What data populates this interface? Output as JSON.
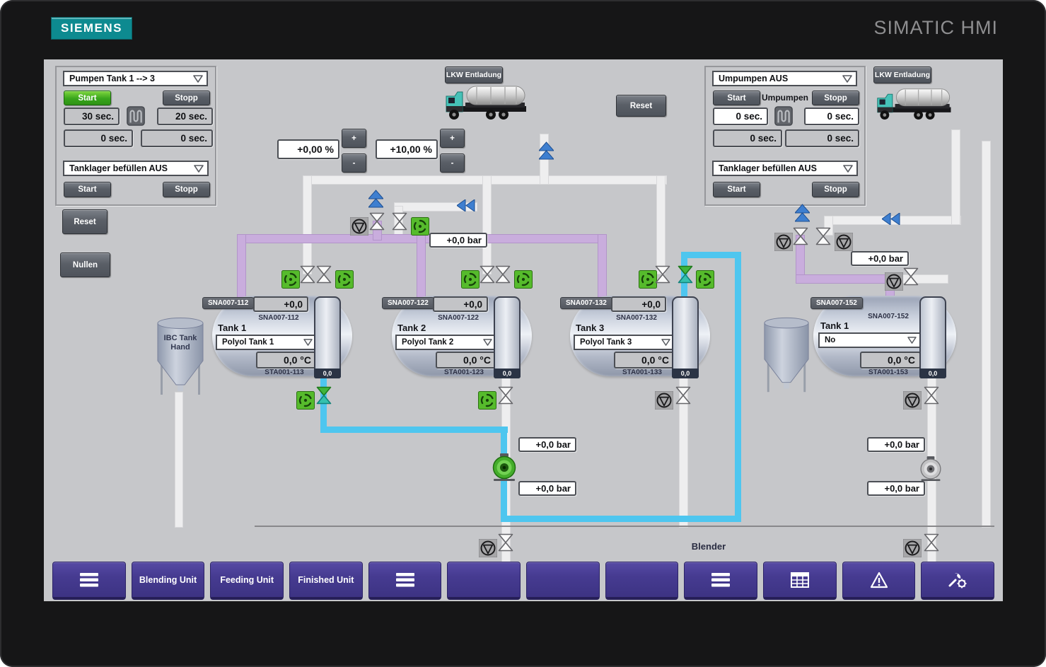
{
  "brand": {
    "logo": "SIEMENS",
    "product": "SIMATIC HMI"
  },
  "panels": {
    "left": {
      "mode": "Pumpen Tank 1 --> 3",
      "start": "Start",
      "stopp": "Stopp",
      "t1": "30 sec.",
      "t2": "20 sec.",
      "t3": "0 sec.",
      "t4": "0 sec.",
      "tanklager": "Tanklager befüllen AUS",
      "start2": "Start",
      "stopp2": "Stopp"
    },
    "right": {
      "mode": "Umpumpen AUS",
      "start": "Start",
      "label": "Umpumpen",
      "stopp": "Stopp",
      "t1": "0 sec.",
      "t2": "0 sec.",
      "t3": "0 sec.",
      "t4": "0 sec.",
      "tanklager": "Tanklager befüllen AUS",
      "start2": "Start",
      "stopp2": "Stopp"
    }
  },
  "buttons": {
    "reset": "Reset",
    "nullen": "Nullen",
    "reset_mid": "Reset",
    "lkw_left": "LKW Entladung",
    "lkw_right": "LKW Entladung"
  },
  "dosing": {
    "v1": "+0,00 %",
    "v2": "+10,00 %",
    "plus": "+",
    "minus": "-"
  },
  "pressures": [
    "+0,0 bar",
    "+0,0 bar",
    "+0,0 bar",
    "+0,0 bar",
    "+0,0 bar",
    "+0,0 bar"
  ],
  "tanks": [
    {
      "badge": "SNA007-112",
      "flow": "+0,0",
      "flow_label": "SNA007-112",
      "title": "Tank 1",
      "select": "Polyol Tank 1",
      "temp": "0,0 °C",
      "temp_label": "STA001-113",
      "level": "0,0"
    },
    {
      "badge": "SNA007-122",
      "flow": "+0,0",
      "flow_label": "SNA007-122",
      "title": "Tank 2",
      "select": "Polyol Tank 2",
      "temp": "0,0 °C",
      "temp_label": "STA001-123",
      "level": "0,0"
    },
    {
      "badge": "SNA007-132",
      "flow": "+0,0",
      "flow_label": "SNA007-132",
      "title": "Tank 3",
      "select": "Polyol Tank 3",
      "temp": "0,0 °C",
      "temp_label": "STA001-133",
      "level": "0,0"
    },
    {
      "badge": "SNA007-152",
      "flow_label": "SNA007-152",
      "title": "Tank 1",
      "select": "No",
      "temp": "0,0 °C",
      "temp_label": "STA001-153",
      "level": "0,0"
    }
  ],
  "labels": {
    "ibc": "IBC Tank Hand",
    "blender": "Blender"
  },
  "nav": {
    "items": [
      {
        "icon": "menu",
        "label": ""
      },
      {
        "icon": "",
        "label": "Blending Unit"
      },
      {
        "icon": "",
        "label": "Feeding Unit"
      },
      {
        "icon": "",
        "label": "Finished Unit"
      },
      {
        "icon": "menu",
        "label": ""
      },
      {
        "icon": "",
        "label": ""
      },
      {
        "icon": "",
        "label": ""
      },
      {
        "icon": "",
        "label": ""
      },
      {
        "icon": "menu",
        "label": ""
      },
      {
        "icon": "grid",
        "label": ""
      },
      {
        "icon": "alarm",
        "label": ""
      },
      {
        "icon": "tools",
        "label": ""
      }
    ]
  },
  "colors": {
    "accent_green": "#3fae27",
    "pipe_purple": "#c9addd",
    "pipe_cyan": "#4ec6ef",
    "nav_purple": "#463b91",
    "siemens_teal": "#0d8a90",
    "start_green": "#38a51c",
    "screen_gray": "#c6c7ca"
  }
}
